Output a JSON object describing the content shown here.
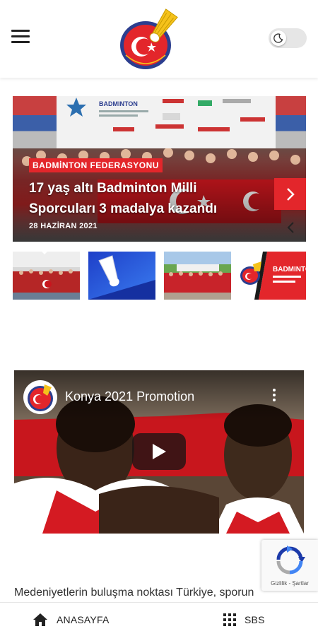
{
  "header": {
    "menu_icon": "hamburger-menu-icon",
    "logo_icon": "federation-logo",
    "theme_icon": "moon-icon"
  },
  "slider": {
    "category": "BADMİNTON FEDERASYONU",
    "title": "17 yaş altı Badminton Milli Sporcuları 3 madalya kazandı",
    "date": "28 HAZİRAN 2021",
    "banner_text": "BADMINTON",
    "accent_color": "#e3262b"
  },
  "thumbnail_banner": "BADMINTON",
  "video": {
    "title": "Konya 2021 Promotion"
  },
  "recaptcha": {
    "links": "Gizlilik - Şartlar"
  },
  "body_text": "Medeniyetlerin buluşma noktası Türkiye, sporun",
  "bottom_nav": {
    "home_label": "ANASAYFA",
    "sbs_label": "SBS"
  }
}
